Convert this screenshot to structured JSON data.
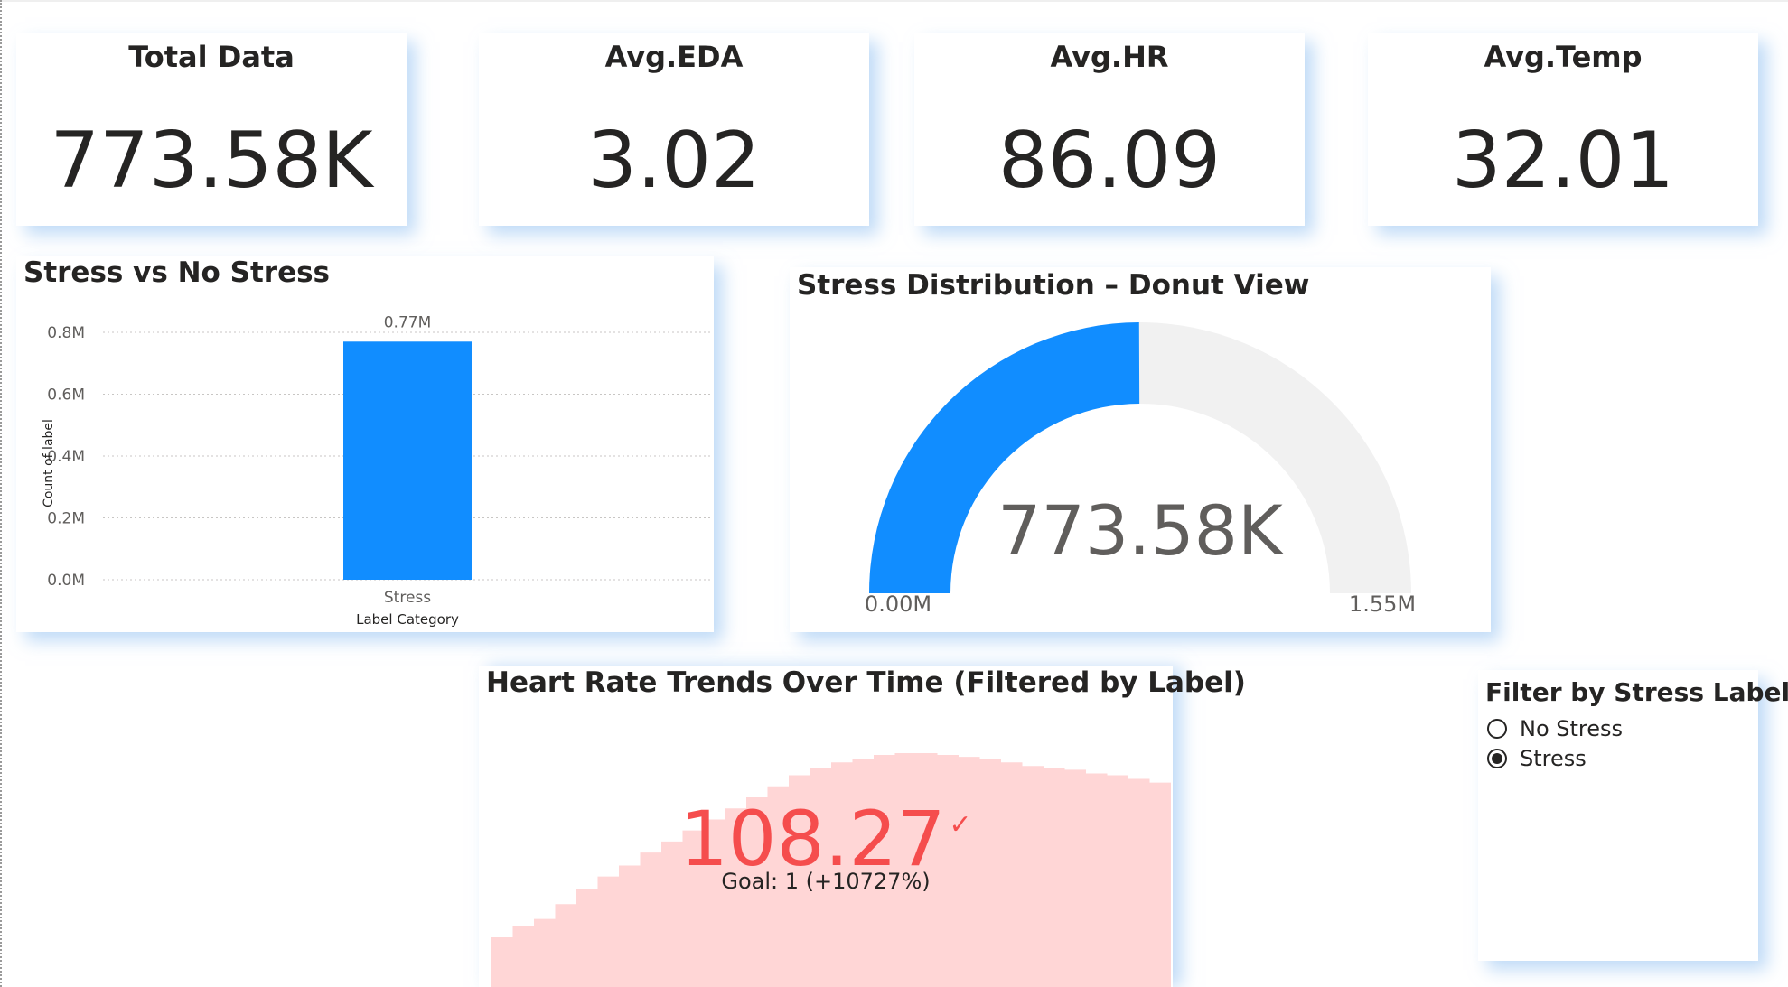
{
  "kpis": [
    {
      "title": "Total Data",
      "value": "773.58K"
    },
    {
      "title": "Avg.EDA",
      "value": "3.02"
    },
    {
      "title": "Avg.HR",
      "value": "86.09"
    },
    {
      "title": "Avg.Temp",
      "value": "32.01"
    }
  ],
  "bar_visual": {
    "title": "Stress vs No Stress",
    "bar_label": "0.77M"
  },
  "gauge_visual": {
    "title": "Stress Distribution – Donut View",
    "center_value": "773.58K",
    "min_label": "0.00M",
    "max_label": "1.55M",
    "colors": {
      "fill": "#118dff",
      "track": "#f1f1f1"
    }
  },
  "hr_visual": {
    "title": "Heart Rate Trends Over Time (Filtered by Label)",
    "value": "108.27",
    "goal": "Goal: 1 (+10727%)",
    "colors": {
      "value": "#f54d4d",
      "area": "#ffd6d6"
    }
  },
  "slicer": {
    "title": "Filter by Stress Label",
    "options": [
      {
        "label": "No Stress",
        "selected": false
      },
      {
        "label": "Stress",
        "selected": true
      }
    ]
  },
  "chart_data": {
    "type": "bar",
    "title": "Stress vs No Stress",
    "categories": [
      "Stress"
    ],
    "values": [
      0.77
    ],
    "data_labels": [
      "0.77M"
    ],
    "xlabel": "Label Category",
    "ylabel": "Count of label",
    "yticks": [
      "0.0M",
      "0.2M",
      "0.4M",
      "0.6M",
      "0.8M"
    ],
    "ytick_values": [
      0,
      0.2,
      0.4,
      0.6,
      0.8
    ],
    "ylim": [
      0,
      0.8
    ],
    "grid": true,
    "color": "#118dff"
  }
}
